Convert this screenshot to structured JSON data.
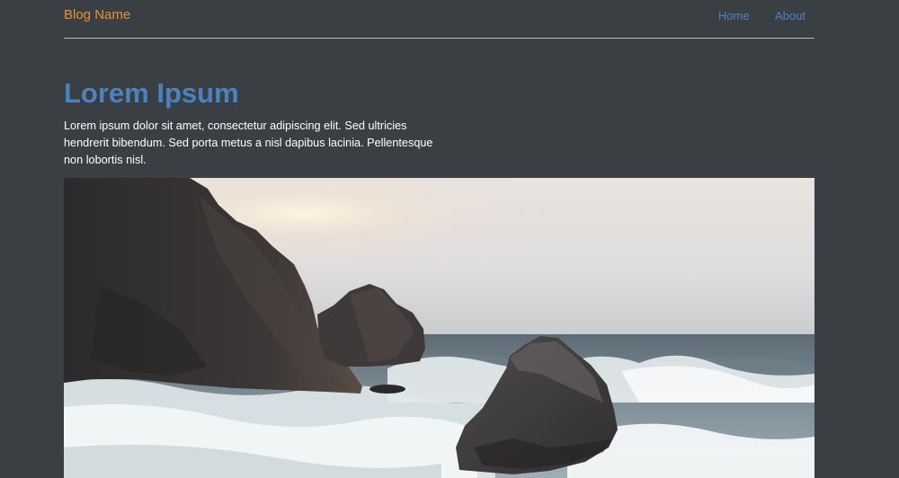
{
  "nav": {
    "brand": "Blog Name",
    "links": [
      "Home",
      "About"
    ]
  },
  "article": {
    "title": "Lorem Ipsum",
    "intro": "Lorem ipsum dolor sit amet, consectetur adipiscing elit. Sed ultricies hendrerit bibendum. Sed porta metus a nisl dapibus lacinia. Pellentesque non lobortis nisl."
  },
  "colors": {
    "background": "#3a3f43",
    "brand": "#e8922e",
    "link": "#4a86c0",
    "title": "#4a83c0"
  }
}
